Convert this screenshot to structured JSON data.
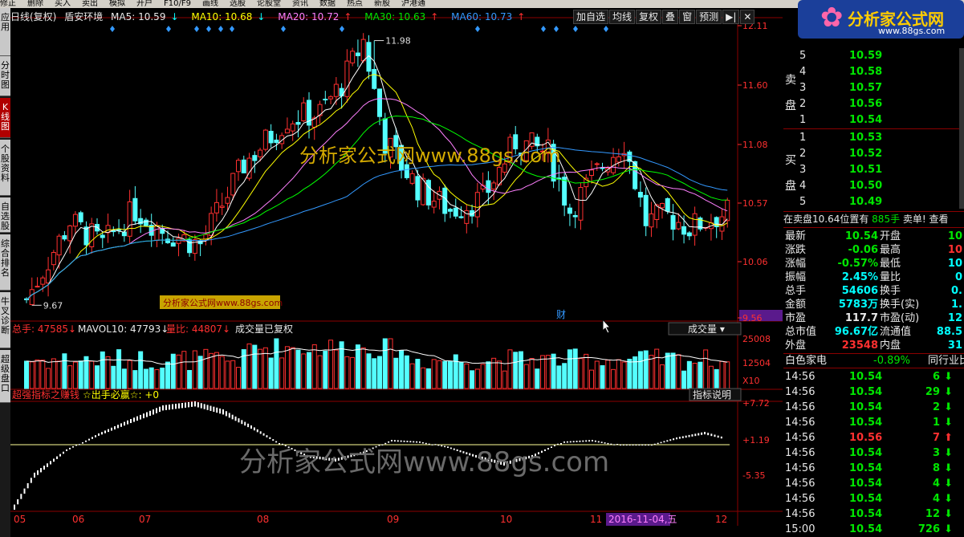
{
  "topbar": [
    "修正",
    "删除",
    "买入",
    "卖出",
    "模拟",
    "开户",
    "F10/F9",
    "画线",
    "选股",
    "论股堂",
    "资讯",
    "数据",
    "热点",
    "新股",
    "沪港通"
  ],
  "lefttabs": [
    "应用",
    "分时图",
    "K线图",
    "个股资料",
    "自选股",
    "综合排名",
    "牛叉诊断",
    "超级盘口"
  ],
  "info": {
    "period": "日线(复权)",
    "stock": "盾安环境",
    "ma5": "MA5: 10.59",
    "ma10": "MA10: 10.68",
    "ma20": "MA20: 10.72",
    "ma30": "MA30: 10.63",
    "ma60": "MA60: 10.73"
  },
  "toolbar": [
    "加自选",
    "均线",
    "复权",
    "叠",
    "窗",
    "预测"
  ],
  "price_axis": [
    "12.11",
    "11.60",
    "11.08",
    "10.57",
    "10.06",
    "9.56"
  ],
  "price_marks": {
    "high": "11.98",
    "low": "9.67"
  },
  "watermark_main": "分析家公式网www.88gs.com",
  "watermark_small": "分析家公式网www.88gs.com",
  "watermark_bottom": "分析家公式网www.88gs.com",
  "event_label": "财",
  "volume": {
    "total": "总手: 47585",
    "mavol": "MAVOL10: 47793",
    "ratio": "量比: 44807",
    "note": "成交量已复权",
    "dropdown": "成交量",
    "axis": [
      "25008",
      "12504",
      "X10"
    ]
  },
  "indicator": {
    "name": "超强指标之赚钱",
    "signal": "☆出手必赢☆: +0",
    "button": "指标说明",
    "axis": [
      "+7.72",
      "+1.19",
      "-5.35"
    ]
  },
  "date_axis": [
    "05",
    "06",
    "07",
    "08",
    "09",
    "10",
    "11",
    "12"
  ],
  "date_cursor": "2016-11-04,五",
  "colors": {
    "up": "#ff3030",
    "down": "#54ffff",
    "ma5": "#ffffff",
    "ma10": "#ffff00",
    "ma20": "#ff80ff",
    "ma30": "#00ff00",
    "ma60": "#3399ff"
  },
  "orderbook": {
    "title_ask": "卖盘",
    "title_bid": "买盘",
    "asks": [
      {
        "lvl": "5",
        "price": "10.59"
      },
      {
        "lvl": "4",
        "price": "10.58"
      },
      {
        "lvl": "3",
        "price": "10.57"
      },
      {
        "lvl": "2",
        "price": "10.56"
      },
      {
        "lvl": "1",
        "price": "10.54"
      }
    ],
    "bids": [
      {
        "lvl": "1",
        "price": "10.53"
      },
      {
        "lvl": "2",
        "price": "10.52"
      },
      {
        "lvl": "3",
        "price": "10.51"
      },
      {
        "lvl": "4",
        "price": "10.50"
      },
      {
        "lvl": "5",
        "price": "10.49"
      }
    ]
  },
  "position": {
    "text": "在卖盘10.64位置有",
    "vol": "885手",
    "tail": "卖单! 查看"
  },
  "quote_rows": [
    {
      "l1": "最新",
      "v1": "10.54",
      "l2": "开盘",
      "v2": "10"
    },
    {
      "l1": "涨跌",
      "v1": "-0.06",
      "l2": "最高",
      "v2": "10"
    },
    {
      "l1": "涨幅",
      "v1": "-0.57%",
      "l2": "最低",
      "v2": "10"
    },
    {
      "l1": "振幅",
      "v1": "2.45%",
      "l2": "量比",
      "v2": "0"
    },
    {
      "l1": "总手",
      "v1": "54606",
      "l2": "换手",
      "v2": "0."
    },
    {
      "l1": "金额",
      "v1": "5783万",
      "l2": "换手(实)",
      "v2": "1."
    },
    {
      "l1": "市盈",
      "v1": "117.7",
      "l2": "市盈(动)",
      "v2": "12"
    },
    {
      "l1": "总市值",
      "v1": "96.67亿",
      "l2": "流通值",
      "v2": "88.5"
    },
    {
      "l1": "外盘",
      "v1": "23548",
      "l2": "内盘",
      "v2": "31"
    }
  ],
  "sector": {
    "name": "白色家电",
    "change": "-0.89%",
    "compare": "同行业比"
  },
  "ticks": [
    {
      "t": "14:56",
      "p": "10.54",
      "v": "6",
      "dir": "down"
    },
    {
      "t": "14:56",
      "p": "10.54",
      "v": "29",
      "dir": "down"
    },
    {
      "t": "14:56",
      "p": "10.54",
      "v": "2",
      "dir": "down"
    },
    {
      "t": "14:56",
      "p": "10.54",
      "v": "1",
      "dir": "down"
    },
    {
      "t": "14:56",
      "p": "10.56",
      "v": "7",
      "dir": "up"
    },
    {
      "t": "14:56",
      "p": "10.54",
      "v": "3",
      "dir": "down"
    },
    {
      "t": "14:56",
      "p": "10.54",
      "v": "8",
      "dir": "down"
    },
    {
      "t": "14:56",
      "p": "10.54",
      "v": "4",
      "dir": "down"
    },
    {
      "t": "14:56",
      "p": "10.54",
      "v": "4",
      "dir": "down"
    },
    {
      "t": "14:56",
      "p": "10.54",
      "v": "12",
      "dir": "down"
    },
    {
      "t": "15:00",
      "p": "10.54",
      "v": "726",
      "dir": "down"
    }
  ],
  "logo": {
    "title": "分析家公式网",
    "url": "www.88gs.com"
  }
}
